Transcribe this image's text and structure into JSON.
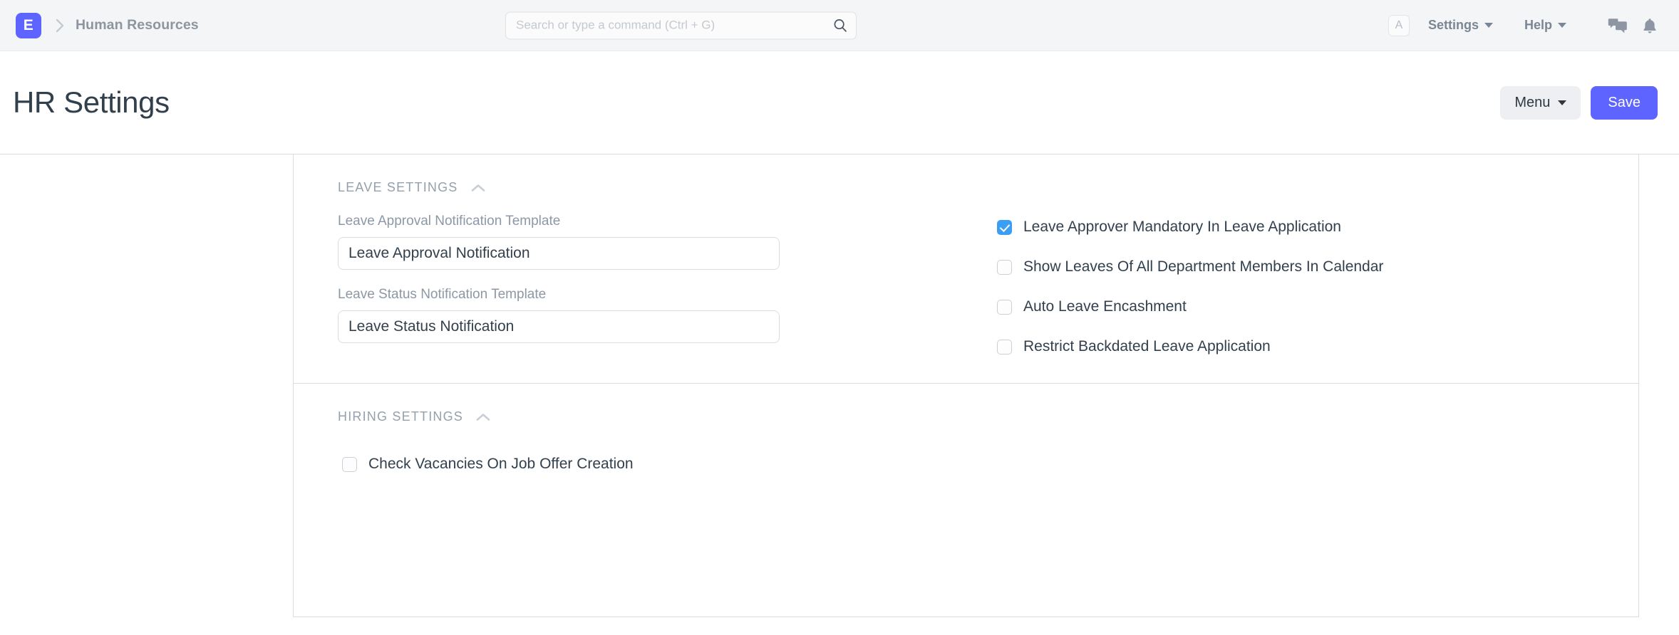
{
  "navbar": {
    "logo_letter": "E",
    "breadcrumb": "Human Resources",
    "search_placeholder": "Search or type a command (Ctrl + G)",
    "search_value": "",
    "avatar_letter": "A",
    "settings_label": "Settings",
    "help_label": "Help",
    "icons": [
      "chat-icon",
      "bell-icon"
    ]
  },
  "page": {
    "title": "HR Settings",
    "menu_label": "Menu",
    "save_label": "Save"
  },
  "colors": {
    "brand": "#5e64ff",
    "checkbox_checked": "#3b9ef5",
    "title_text": "#32404e",
    "muted_text": "#8d98a6",
    "border": "#d8dde3",
    "navbar_bg": "#f4f5f6"
  },
  "sections": [
    {
      "title": "Leave Settings",
      "collapse_icon": "chevron-up-icon",
      "fields": [
        {
          "label": "Leave Approval Notification Template",
          "value": "Leave Approval Notification",
          "placeholder": ""
        },
        {
          "label": "Leave Status Notification Template",
          "value": "Leave Status Notification",
          "placeholder": ""
        }
      ],
      "checkboxes": [
        {
          "label": "Leave Approver Mandatory In Leave Application",
          "checked": true
        },
        {
          "label": "Show Leaves Of All Department Members In Calendar",
          "checked": false
        },
        {
          "label": "Auto Leave Encashment",
          "checked": false
        },
        {
          "label": "Restrict Backdated Leave Application",
          "checked": false
        }
      ]
    },
    {
      "title": "Hiring Settings",
      "collapse_icon": "chevron-up-icon",
      "fields": [],
      "checkboxes": [
        {
          "label": "Check Vacancies On Job Offer Creation",
          "checked": false
        }
      ]
    }
  ]
}
